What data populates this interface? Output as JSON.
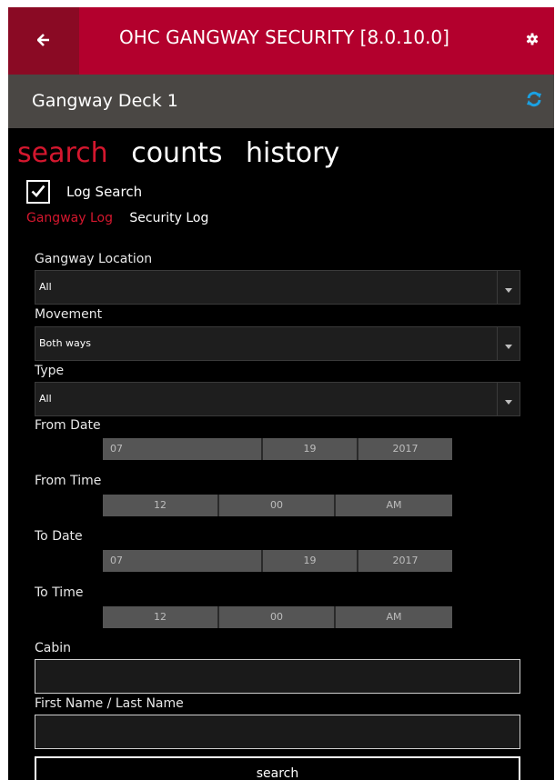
{
  "header": {
    "title": "OHC GANGWAY SECURITY [8.0.10.0]",
    "back_icon": "arrow-left-icon",
    "settings_icon": "gear-icon",
    "accent": "#b3002d",
    "accent_dark": "#8a0a24"
  },
  "subheader": {
    "title": "Gangway Deck 1",
    "refresh_icon": "refresh-icon",
    "refresh_color": "#1ba1e2"
  },
  "tabs": [
    {
      "label": "search",
      "active": true
    },
    {
      "label": "counts",
      "active": false
    },
    {
      "label": "history",
      "active": false
    }
  ],
  "log_search": {
    "label": "Log Search",
    "checked": true
  },
  "subtabs": [
    {
      "label": "Gangway Log",
      "active": true
    },
    {
      "label": "Security Log",
      "active": false
    }
  ],
  "form": {
    "location_label": "Gangway Location",
    "location_value": "All",
    "movement_label": "Movement",
    "movement_value": "Both ways",
    "type_label": "Type",
    "type_value": "All",
    "from_date_label": "From Date",
    "from_date": {
      "month": "07",
      "day": "19",
      "year": "2017"
    },
    "from_time_label": "From Time",
    "from_time": {
      "hour": "12",
      "minute": "00",
      "ampm": "AM"
    },
    "to_date_label": "To Date",
    "to_date": {
      "month": "07",
      "day": "19",
      "year": "2017"
    },
    "to_time_label": "To Time",
    "to_time": {
      "hour": "12",
      "minute": "00",
      "ampm": "AM"
    },
    "cabin_label": "Cabin",
    "cabin_value": "",
    "name_label": "First Name / Last Name",
    "name_value": "",
    "search_label": "search"
  }
}
